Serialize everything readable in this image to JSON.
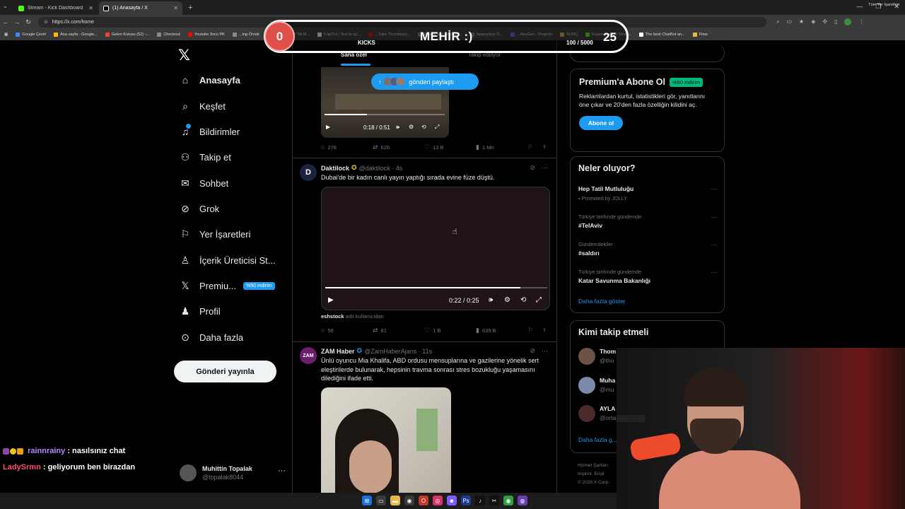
{
  "browser": {
    "tabs": [
      {
        "title": "Stream - Kick Dashboard",
        "active": false,
        "color": "#53fc18"
      },
      {
        "title": "(1) Anasayfa / X",
        "active": true,
        "color": "#000000"
      }
    ],
    "url": "https://x.com/home",
    "bookmarks": [
      {
        "label": "Google Çeviri",
        "color": "#4285f4"
      },
      {
        "label": "Ana sayfa - Google...",
        "color": "#fbbc04"
      },
      {
        "label": "Gelen Kutusu (52) -...",
        "color": "#ea4335"
      },
      {
        "label": "Checkout",
        "color": "#888888"
      },
      {
        "label": "Youtube 3ncü PK",
        "color": "#ff0000"
      },
      {
        "label": "...ing Örnek",
        "color": "#888888"
      },
      {
        "label": "Transcript of \"Mi M...",
        "color": "#888888"
      },
      {
        "label": "CapCut | Text to sp...",
        "color": "#ffffff"
      },
      {
        "label": "...Tube Thumbnail...",
        "color": "#ff0000"
      },
      {
        "label": "Resize and reduce i...",
        "color": "#888888"
      },
      {
        "label": "İspanyolca Ö...",
        "color": "#888888"
      },
      {
        "label": "...HeyGen - Projects",
        "color": "#7c5cff"
      },
      {
        "label": "BURÇ",
        "color": "#e8b84a"
      },
      {
        "label": "Esperanza000 Strea...",
        "color": "#53fc18"
      },
      {
        "label": "The best ChatBot an...",
        "color": "#ffffff"
      },
      {
        "label": "Flow",
        "color": "#e8b84a"
      }
    ],
    "all_bookmarks": "Tüm Yer İşaretleri"
  },
  "kick_overlay": {
    "left_value": "0",
    "name": "MEHİR :)",
    "right_value": "25",
    "label": "KICKS",
    "progress_text": "100 / 5000",
    "progress": 0.02
  },
  "x": {
    "nav": [
      {
        "label": "Anasayfa",
        "icon": "home-icon",
        "glyph": "⌂",
        "active": true
      },
      {
        "label": "Keşfet",
        "icon": "search-icon",
        "glyph": "⌕",
        "active": false
      },
      {
        "label": "Bildirimler",
        "icon": "bell-icon",
        "glyph": "♫",
        "active": false
      },
      {
        "label": "Takip et",
        "icon": "add-user-icon",
        "glyph": "⚇",
        "active": false
      },
      {
        "label": "Sohbet",
        "icon": "mail-icon",
        "glyph": "✉",
        "active": false
      },
      {
        "label": "Grok",
        "icon": "grok-icon",
        "glyph": "⊘",
        "active": false
      },
      {
        "label": "Yer İşaretleri",
        "icon": "bookmark-icon",
        "glyph": "⚐",
        "active": false
      },
      {
        "label": "İçerik Üreticisi St...",
        "icon": "creator-icon",
        "glyph": "♙",
        "active": false
      },
      {
        "label": "Premiu...",
        "icon": "x-premium-icon",
        "glyph": "𝕏",
        "active": false,
        "badge": "%50 indirim"
      },
      {
        "label": "Profil",
        "icon": "profile-icon",
        "glyph": "♟",
        "active": false
      },
      {
        "label": "Daha fazla",
        "icon": "more-circle-icon",
        "glyph": "⊙",
        "active": false
      }
    ],
    "post_button": "Gönderi yayınla",
    "me": {
      "name": "Muhittin Topalak",
      "handle": "@topalak8044"
    },
    "tabs": [
      "Sana özel",
      "Takip ediliyor"
    ],
    "share_pill": "gönderi paylaştı",
    "tweets": [
      {
        "video_time": "0:18 / 0:51",
        "video_progress": 0.35,
        "replies": "278",
        "reposts": "626",
        "likes": "13 B",
        "views": "1 Mn"
      },
      {
        "name": "Daktilock",
        "handle": "@daktilock",
        "time": "4s",
        "text": "Dubai'de bir kadın canlı yayın yaptığı sırada evine füze düştü.",
        "video_time": "0:22 / 0:25",
        "video_progress": 0.88,
        "credit_user": "eshstock",
        "credit_text": "adlı kullanıcıdan",
        "replies": "56",
        "reposts": "81",
        "likes": "1 B",
        "views": "639 B",
        "avatar_letter": "D",
        "avatar_color": "#1a2340"
      },
      {
        "name": "ZAM Haber",
        "handle": "@ZamHaberAjans",
        "time": "11s",
        "text": "Ünlü oyuncu Mia Khalifa, ABD ordusu mensuplarına ve gazilerine yönelik sert eleştirilerde bulunarak, hepsinin travma sonrası stres bozukluğu yaşamasını dilediğini ifade etti.",
        "avatar_letter": "ZAM",
        "avatar_color": "#6d1d6b"
      }
    ],
    "premium": {
      "title": "Premium'a Abone Ol",
      "discount": "%50 indirim",
      "text": "Reklamlardan kurtul, istatistikleri gör, yanıtlarını öne çıkar ve 20'den fazla özelliğin kilidini aç.",
      "button": "Abone ol"
    },
    "trends": {
      "title": "Neler oluyor?",
      "items": [
        {
          "context": "",
          "title": "Hep Tatil Mutluluğu",
          "sub": "Promoted by JOLLY"
        },
        {
          "context": "Türkiye tarihinde gündemde",
          "title": "#TelAviv"
        },
        {
          "context": "Gündemdekiler",
          "title": "#saldırı"
        },
        {
          "context": "Türkiye tarihinde gündemde",
          "title": "Katar Savunma Bakanlığı"
        }
      ],
      "show_more": "Daha fazla göster"
    },
    "who_to_follow": {
      "title": "Kimi takip etmeli",
      "items": [
        {
          "name": "Thom",
          "handle": "@tho"
        },
        {
          "name": "Muha",
          "handle": "@mu"
        },
        {
          "name": "AYLA",
          "handle": "@orta"
        }
      ],
      "show_more": "Daha fazla g..."
    },
    "footer": [
      "Hizmet Şartları",
      "Imprint",
      "Erişil",
      "© 2026 X Corp."
    ]
  },
  "chat": [
    {
      "user": "rainnrainy",
      "message": ": nasılsınız chat",
      "color": "#b388ff"
    },
    {
      "user": "LadySrmn",
      "message": ": geliyorum ben birazdan",
      "color": "#ff4d6d"
    }
  ]
}
